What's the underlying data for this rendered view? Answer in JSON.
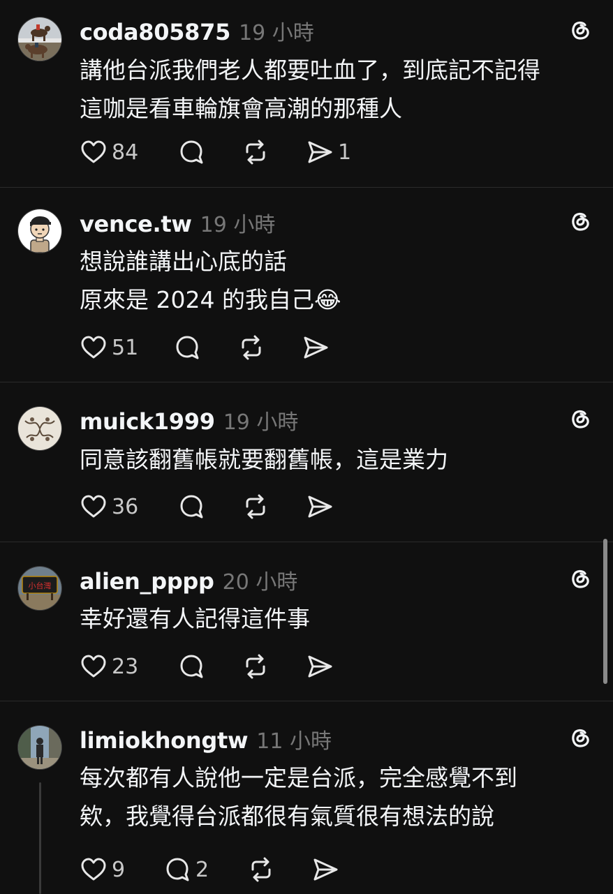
{
  "posts": [
    {
      "username": "coda805875",
      "time": "19 小時",
      "text": "講他台派我們老人都要吐血了，到底記不記得\n這咖是看車輪旗會高潮的那種人",
      "likes": "84",
      "replies": "",
      "shares": "1",
      "avatar_icon": "horse-racing-avatar"
    },
    {
      "username": "vence.tw",
      "time": "19 小時",
      "text": "想說誰講出心底的話\n原來是 2024 的我自己😂",
      "likes": "51",
      "replies": "",
      "shares": "",
      "avatar_icon": "cartoon-man-avatar"
    },
    {
      "username": "muick1999",
      "time": "19 小時",
      "text": "同意該翻舊帳就要翻舊帳，這是業力",
      "likes": "36",
      "replies": "",
      "shares": "",
      "avatar_icon": "sketch-figures-avatar"
    },
    {
      "username": "alien_pppp",
      "time": "20 小時",
      "text": "幸好還有人記得這件事",
      "likes": "23",
      "replies": "",
      "shares": "",
      "avatar_icon": "sign-avatar",
      "avatar_text": "小台灣"
    },
    {
      "username": "limiokhongtw",
      "time": "11 小時",
      "text": "每次都有人說他一定是台派，完全感覺不到\n欸，我覺得台派都很有氣質很有想法的說",
      "likes": "9",
      "replies": "2",
      "shares": "",
      "avatar_icon": "street-photo-avatar"
    }
  ],
  "colors": {
    "background": "#101010",
    "text_primary": "#f3f5f7",
    "text_secondary": "#777777",
    "divider": "#2b2b2b"
  }
}
